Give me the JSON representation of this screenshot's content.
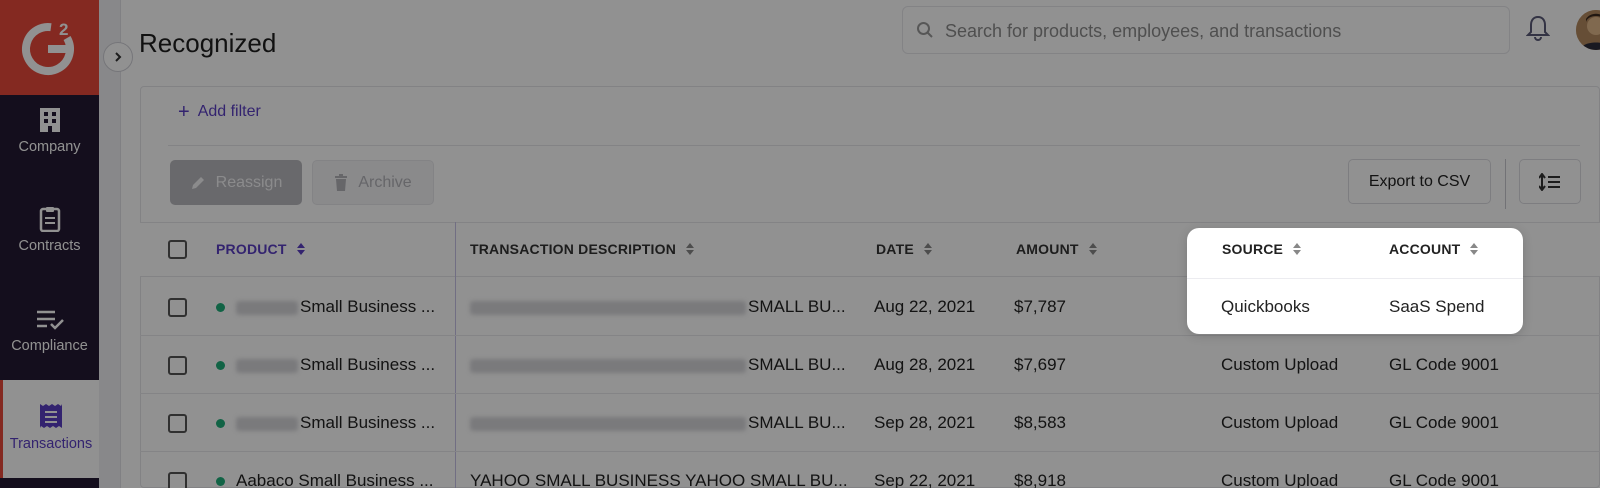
{
  "app": {
    "logo_text": "G2"
  },
  "sidebar": {
    "items": [
      {
        "label": "Company",
        "icon": "building-icon"
      },
      {
        "label": "Contracts",
        "icon": "clipboard-icon"
      },
      {
        "label": "Compliance",
        "icon": "list-check-icon"
      },
      {
        "label": "Transactions",
        "icon": "receipt-icon",
        "active": true
      }
    ]
  },
  "header": {
    "title": "Recognized",
    "search_placeholder": "Search for products, employees, and transactions"
  },
  "filters": {
    "add_filter_label": "Add filter"
  },
  "toolbar": {
    "reassign_label": "Reassign",
    "archive_label": "Archive",
    "export_label": "Export to CSV"
  },
  "table": {
    "columns": {
      "product": "PRODUCT",
      "description": "TRANSACTION DESCRIPTION",
      "date": "DATE",
      "amount": "AMOUNT",
      "source": "SOURCE",
      "account": "ACCOUNT"
    },
    "rows": [
      {
        "product": "Small Business ...",
        "description": "SMALL BU...",
        "date": "Aug 22, 2021",
        "amount": "$7,787",
        "source": "Quickbooks",
        "account": "SaaS Spend"
      },
      {
        "product": "Small Business ...",
        "description": "SMALL BU...",
        "date": "Aug 28, 2021",
        "amount": "$7,697",
        "source": "Custom Upload",
        "account": "GL Code 9001"
      },
      {
        "product": "Small Business ...",
        "description": "SMALL BU...",
        "date": "Sep 28, 2021",
        "amount": "$8,583",
        "source": "Custom Upload",
        "account": "GL Code 9001"
      },
      {
        "product": "Aabaco Small Business ...",
        "description": "YAHOO SMALL BUSINESS YAHOO SMALL BU...",
        "date": "Sep 22, 2021",
        "amount": "$8,918",
        "source": "Custom Upload",
        "account": "GL Code 9001"
      }
    ]
  },
  "colors": {
    "brand_red": "#e8493a",
    "sidebar_bg": "#241a33",
    "accent_purple": "#5b3fc4",
    "status_green": "#1fae7a"
  }
}
